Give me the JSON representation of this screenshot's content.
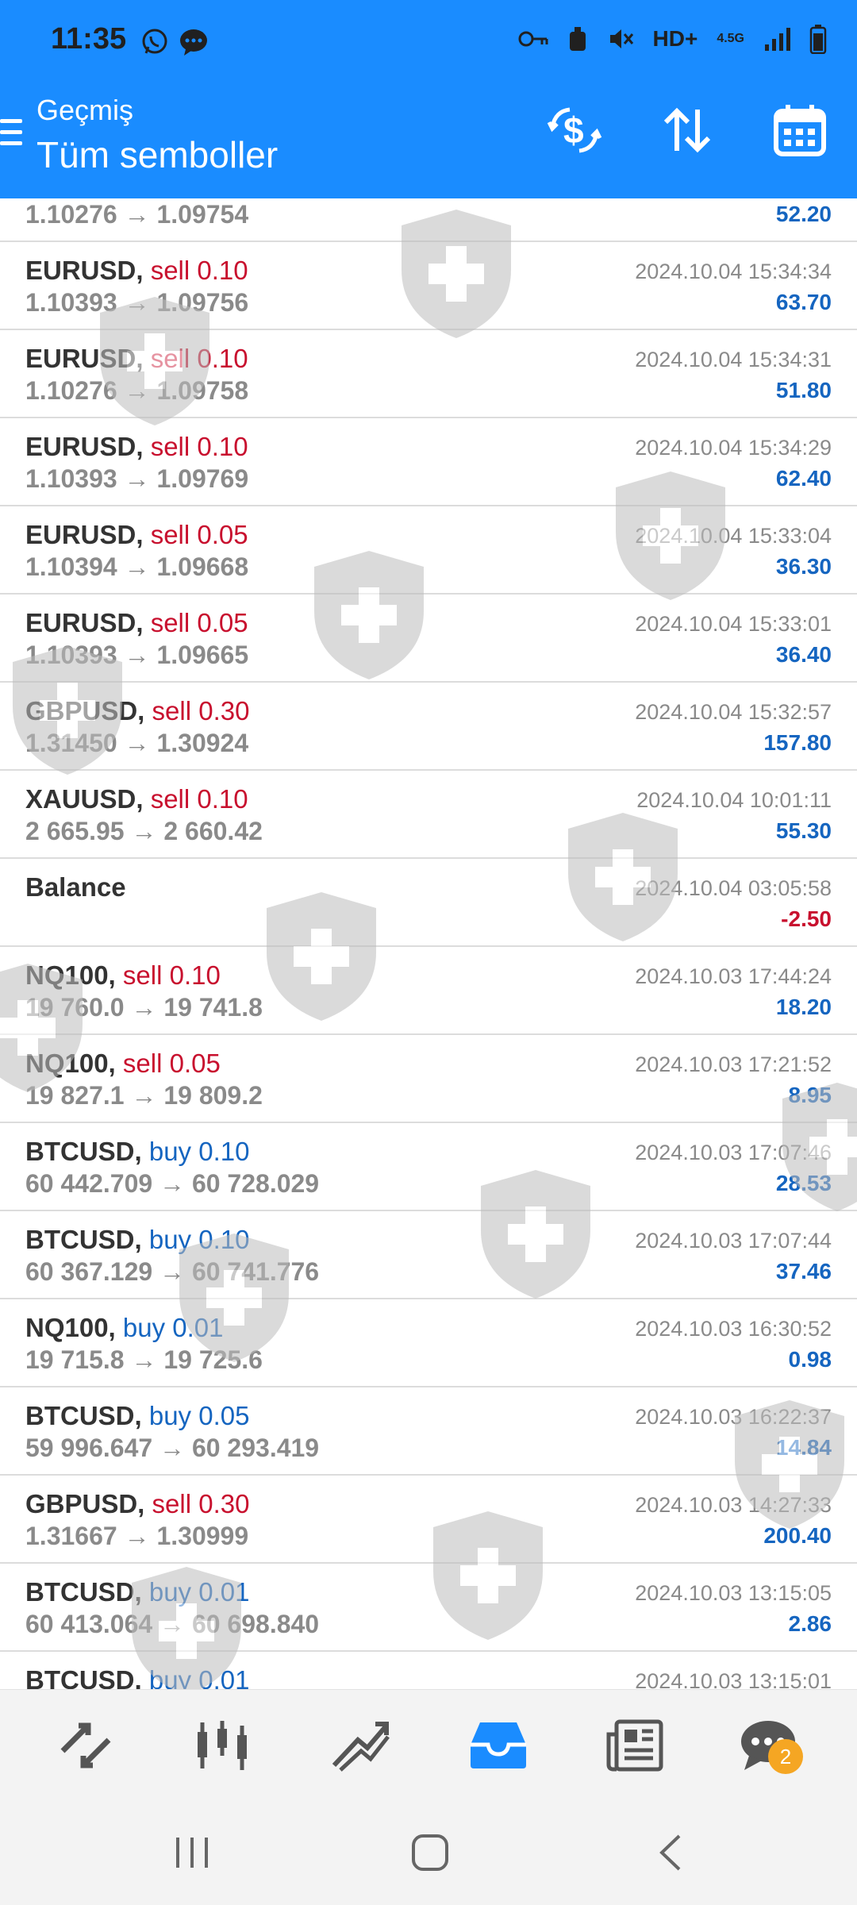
{
  "status_bar": {
    "time": "11:35",
    "icons_left": [
      "whatsapp-icon",
      "messenger-icon"
    ],
    "icons_right": [
      "key-icon",
      "alarm-icon",
      "mute-icon",
      "hd-voice-icon",
      "4g-icon",
      "signal-icon",
      "battery-icon"
    ],
    "hd_label": "HD+",
    "network_label": "4.5G"
  },
  "header": {
    "subtitle": "Geçmiş",
    "title": "Tüm semboller",
    "actions": [
      "currency-exchange-icon",
      "sort-icon",
      "calendar-icon"
    ]
  },
  "colors": {
    "appbar": "#1a8cff",
    "sell": "#c8102e",
    "buy": "#1565c0",
    "profit_positive": "#1565c0",
    "profit_negative": "#c8102e",
    "muted": "#8a8a8a",
    "badge": "#f5a623"
  },
  "history": {
    "partial_top": {
      "prices": "1.10276 → 1.09754",
      "profit": "52.20"
    },
    "rows": [
      {
        "symbol": "EURUSD,",
        "side": "sell",
        "side_label": "sell 0.10",
        "prices": "1.10393 → 1.09756",
        "time": "2024.10.04 15:34:34",
        "profit": "63.70"
      },
      {
        "symbol": "EURUSD,",
        "side": "sell",
        "side_label": "sell 0.10",
        "prices": "1.10276 → 1.09758",
        "time": "2024.10.04 15:34:31",
        "profit": "51.80"
      },
      {
        "symbol": "EURUSD,",
        "side": "sell",
        "side_label": "sell 0.10",
        "prices": "1.10393 → 1.09769",
        "time": "2024.10.04 15:34:29",
        "profit": "62.40"
      },
      {
        "symbol": "EURUSD,",
        "side": "sell",
        "side_label": "sell 0.05",
        "prices": "1.10394 → 1.09668",
        "time": "2024.10.04 15:33:04",
        "profit": "36.30"
      },
      {
        "symbol": "EURUSD,",
        "side": "sell",
        "side_label": "sell 0.05",
        "prices": "1.10393 → 1.09665",
        "time": "2024.10.04 15:33:01",
        "profit": "36.40"
      },
      {
        "symbol": "GBPUSD,",
        "side": "sell",
        "side_label": "sell 0.30",
        "prices": "1.31450 → 1.30924",
        "time": "2024.10.04 15:32:57",
        "profit": "157.80"
      },
      {
        "symbol": "XAUUSD,",
        "side": "sell",
        "side_label": "sell 0.10",
        "prices": "2 665.95 → 2 660.42",
        "time": "2024.10.04 10:01:11",
        "profit": "55.30"
      },
      {
        "symbol": "Balance",
        "side": "none",
        "side_label": "",
        "prices": "",
        "time": "2024.10.04 03:05:58",
        "profit": "-2.50"
      },
      {
        "symbol": "NQ100,",
        "side": "sell",
        "side_label": "sell 0.10",
        "prices": "19 760.0 → 19 741.8",
        "time": "2024.10.03 17:44:24",
        "profit": "18.20"
      },
      {
        "symbol": "NQ100,",
        "side": "sell",
        "side_label": "sell 0.05",
        "prices": "19 827.1 → 19 809.2",
        "time": "2024.10.03 17:21:52",
        "profit": "8.95"
      },
      {
        "symbol": "BTCUSD,",
        "side": "buy",
        "side_label": "buy 0.10",
        "prices": "60 442.709 → 60 728.029",
        "time": "2024.10.03 17:07:46",
        "profit": "28.53"
      },
      {
        "symbol": "BTCUSD,",
        "side": "buy",
        "side_label": "buy 0.10",
        "prices": "60 367.129 → 60 741.776",
        "time": "2024.10.03 17:07:44",
        "profit": "37.46"
      },
      {
        "symbol": "NQ100,",
        "side": "buy",
        "side_label": "buy 0.01",
        "prices": "19 715.8 → 19 725.6",
        "time": "2024.10.03 16:30:52",
        "profit": "0.98"
      },
      {
        "symbol": "BTCUSD,",
        "side": "buy",
        "side_label": "buy 0.05",
        "prices": "59 996.647 → 60 293.419",
        "time": "2024.10.03 16:22:37",
        "profit": "14.84"
      },
      {
        "symbol": "GBPUSD,",
        "side": "sell",
        "side_label": "sell 0.30",
        "prices": "1.31667 → 1.30999",
        "time": "2024.10.03 14:27:33",
        "profit": "200.40"
      },
      {
        "symbol": "BTCUSD,",
        "side": "buy",
        "side_label": "buy 0.01",
        "prices": "60 413.064 → 60 698.840",
        "time": "2024.10.03 13:15:05",
        "profit": "2.86"
      },
      {
        "symbol": "BTCUSD,",
        "side": "buy",
        "side_label": "buy 0.01",
        "prices": "",
        "time": "2024.10.03 13:15:01",
        "profit": ""
      }
    ]
  },
  "bottom_nav": {
    "items": [
      "quotes-icon",
      "chart-icon",
      "trade-icon",
      "history-icon",
      "news-icon",
      "chat-icon"
    ],
    "active": "history-icon",
    "chat_badge": "2"
  },
  "system_nav": [
    "recents-button",
    "home-button",
    "back-button"
  ]
}
